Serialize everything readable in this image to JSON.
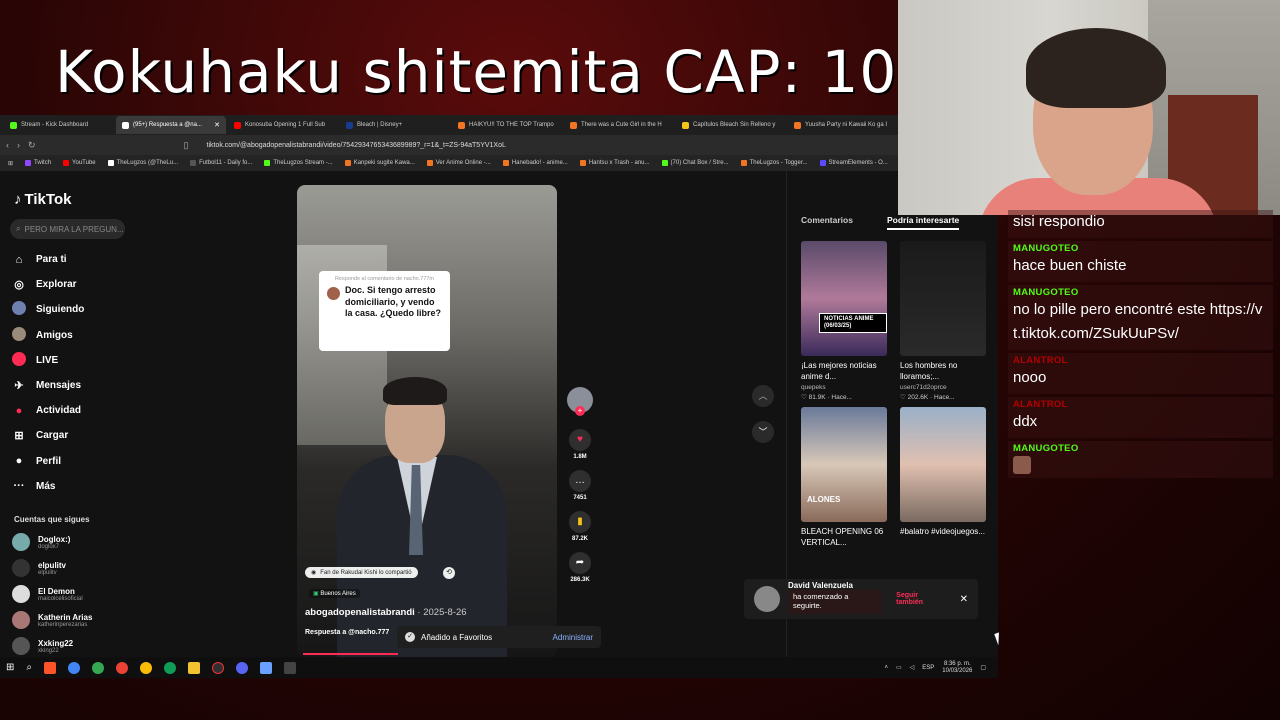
{
  "stream": {
    "title": "Kokuhaku shitemita CAP: 10"
  },
  "browser": {
    "tabs": [
      {
        "label": "Stream - Kick Dashboard",
        "color": "#53fc18"
      },
      {
        "label": "(95+) Respuesta a @na...",
        "color": "#ffffff"
      },
      {
        "label": "Konosuba Opening 1 Full Sub",
        "color": "#ff0000"
      },
      {
        "label": "Bleach | Disney+",
        "color": "#1a3c8f"
      },
      {
        "label": "HAIKYU!! TO THE TOP Trampo",
        "color": "#f47521"
      },
      {
        "label": "There was a Cute Girl in the H",
        "color": "#f47521"
      },
      {
        "label": "Capítulos Bleach Sin Relleno y",
        "color": "#f5c518"
      },
      {
        "label": "Yuusha Party ni Kawaii Ko ga I",
        "color": "#f47521"
      }
    ],
    "url": "tiktok.com/@abogadopenalistabrandi/video/7542934765343689989?_r=1&_t=ZS-94aT5YV1XoL",
    "bookmarks": [
      {
        "label": "Twitch",
        "color": "#9146ff"
      },
      {
        "label": "YouTube",
        "color": "#ff0000"
      },
      {
        "label": "TheLugzos (@TheLu...",
        "color": "#ffffff"
      },
      {
        "label": "Futbol11 - Daily fo...",
        "color": "#555555"
      },
      {
        "label": "TheLugzos Stream -...",
        "color": "#53fc18"
      },
      {
        "label": "Kanpeki sugite Kawa...",
        "color": "#f47521"
      },
      {
        "label": "Ver Anime Online -...",
        "color": "#f47521"
      },
      {
        "label": "Hanebado! - anime...",
        "color": "#f47521"
      },
      {
        "label": "Hantsu x Trash - anu...",
        "color": "#f47521"
      },
      {
        "label": "(70) Chat Box / Stre...",
        "color": "#53fc18"
      },
      {
        "label": "TheLugzos - Togger...",
        "color": "#f47521"
      },
      {
        "label": "StreamElements - O...",
        "color": "#5b4bff"
      }
    ]
  },
  "tiktok": {
    "logo": "TikTok",
    "search_placeholder": "PERO MIRA LA PREGUN...",
    "nav": [
      {
        "label": "Para ti",
        "icon": "home-icon"
      },
      {
        "label": "Explorar",
        "icon": "compass-icon"
      },
      {
        "label": "Siguiendo",
        "icon": "following-icon"
      },
      {
        "label": "Amigos",
        "icon": "friends-icon"
      },
      {
        "label": "LIVE",
        "icon": "live-icon"
      },
      {
        "label": "Mensajes",
        "icon": "messages-icon"
      },
      {
        "label": "Actividad",
        "icon": "activity-icon"
      },
      {
        "label": "Cargar",
        "icon": "upload-icon"
      },
      {
        "label": "Perfil",
        "icon": "profile-icon"
      },
      {
        "label": "Más",
        "icon": "more-icon"
      }
    ],
    "following_title": "Cuentas que sigues",
    "following": [
      {
        "name": "Doglox:)",
        "handle": "doglox7"
      },
      {
        "name": "elpulitv",
        "handle": "elpulitv"
      },
      {
        "name": "El Demon",
        "handle": "maicolcelisoficial"
      },
      {
        "name": "Katherin Arias",
        "handle": "katherinperezarias"
      },
      {
        "name": "Xxking22",
        "handle": "xking22"
      }
    ],
    "video": {
      "reply_label": "Responde al comentario de nacho.777m",
      "reply_text": "Doc. Si tengo arresto domiciliario, y vendo la casa. ¿Quedo libre?",
      "effect": "Fan de Rakudai Kishi lo compartió",
      "location": "Buenos Aires",
      "author": "abogadopenalistabrandi",
      "date": " · 2025-8-26",
      "caption": "Respuesta a @nacho.777",
      "likes": "1.8M",
      "comments": "7451",
      "saves": "87.2K",
      "shares": "286.3K"
    },
    "favorites_toast": {
      "text": "Añadido a Favoritos",
      "action": "Administrar"
    },
    "right_tabs": [
      "Comentarios",
      "Podría interesarte"
    ],
    "recommended": [
      {
        "title": "¡Las mejores noticias anime d...",
        "user": "quepeks",
        "stats": "♡ 81.9K · Hace...",
        "tag": "NOTICIAS ANIME (06/03/25)"
      },
      {
        "title": "Los hombres no lloramos;...",
        "user": "",
        "stats": "♡ 202.6K · Hace...",
        "tag": "userc71d2oprce"
      },
      {
        "title": "BLEACH OPENING 06 VERTICAL...",
        "user": "",
        "stats": "",
        "tag": "ALONES"
      },
      {
        "title": "#balatro #videojuegos...",
        "user": "",
        "stats": "",
        "tag": ""
      }
    ],
    "follow_toast": {
      "name": "David Valenzuela",
      "message": "ha comenzado a seguirte.",
      "action": "Seguir también"
    }
  },
  "taskbar": {
    "lang": "ESP",
    "time": "8:36 p. m.",
    "date": "10/03/2026"
  },
  "chat": [
    {
      "user": "",
      "text": "sisi respondio",
      "color": "#53fc18"
    },
    {
      "user": "MANUGOTEO",
      "text": "hace buen chiste",
      "color": "#53fc18"
    },
    {
      "user": "MANUGOTEO",
      "text": "no lo pille pero encontré este https://vt.tiktok.com/ZSukUuPSv/",
      "color": "#53fc18"
    },
    {
      "user": "ALANTROL",
      "text": "nooo",
      "color": "#b30000"
    },
    {
      "user": "ALANTROL",
      "text": "ddx",
      "color": "#b30000"
    },
    {
      "user": "MANUGOTEO",
      "text": "",
      "color": "#53fc18"
    }
  ]
}
